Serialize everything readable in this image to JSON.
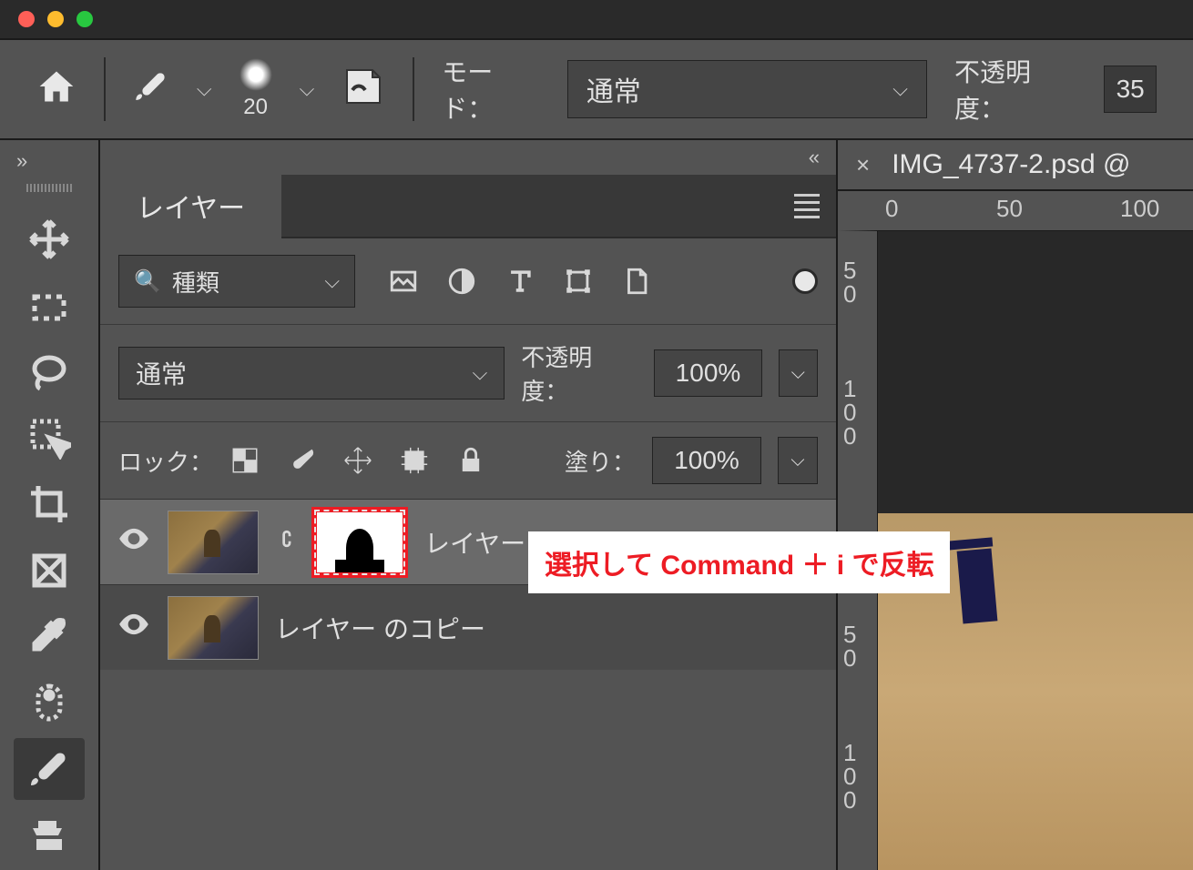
{
  "options_bar": {
    "brush_size": "20",
    "mode_label": "モード：",
    "mode_value": "通常",
    "opacity_label": "不透明度：",
    "opacity_value": "35"
  },
  "panel": {
    "title": "レイヤー",
    "filter_label": "種類",
    "blend_mode": "通常",
    "opacity_label": "不透明度：",
    "opacity_value": "100%",
    "lock_label": "ロック：",
    "fill_label": "塗り：",
    "fill_value": "100%"
  },
  "layers": [
    {
      "name": "レイヤー",
      "selected": true,
      "has_mask": true
    },
    {
      "name": "レイヤー のコピー",
      "selected": false,
      "has_mask": false
    }
  ],
  "annotation": "選択して Command ＋ i で反転",
  "document": {
    "name": "IMG_4737-2.psd @"
  },
  "ruler_h": [
    "0",
    "50",
    "100"
  ],
  "ruler_v": [
    "50",
    "100",
    "50",
    "100"
  ]
}
